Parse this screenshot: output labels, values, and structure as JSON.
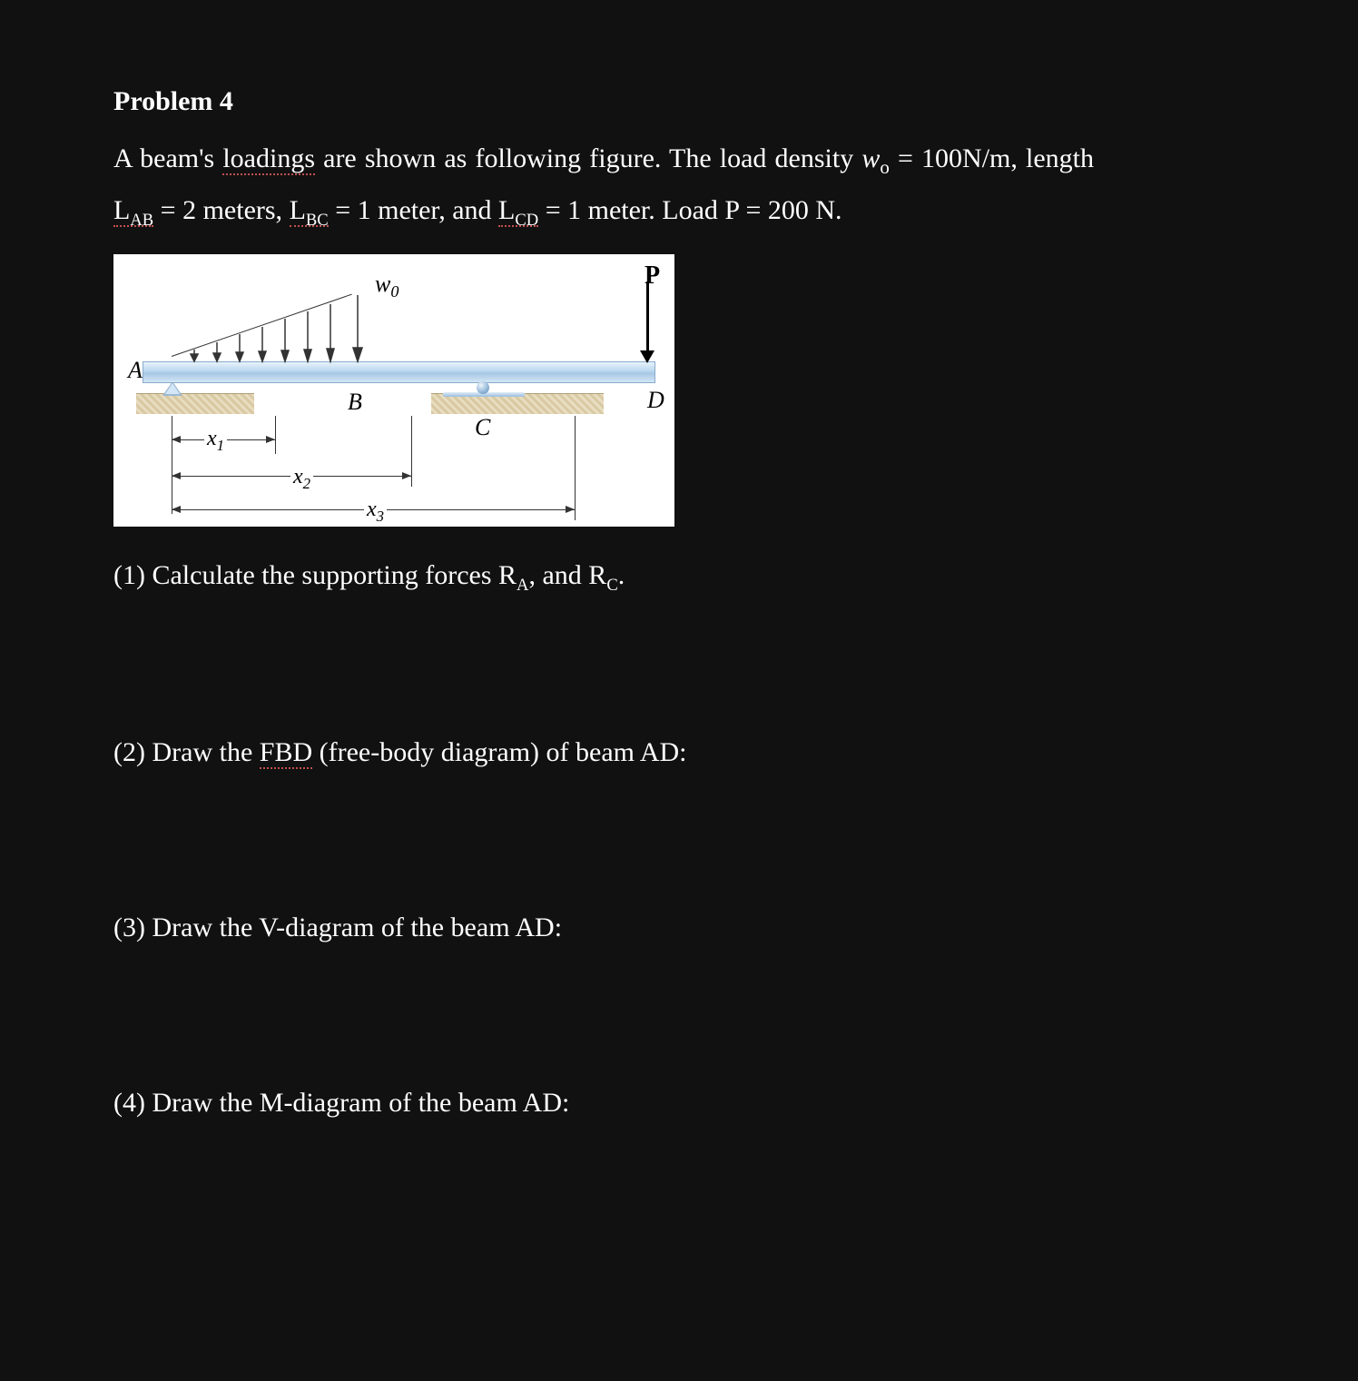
{
  "heading": "Problem 4",
  "desc_part1": "A beam's ",
  "desc_loadings": "loadings",
  "desc_part2": " are shown as following figure. The load density ",
  "wo_sym": "w",
  "wo_sub": "o",
  "desc_part3": " = 100N/m, length ",
  "L_txt": "L",
  "AB_sub": "AB",
  "eq2m": " =  2 meters, ",
  "BC_sub": "BC",
  "eq1m": " = 1 meter, and ",
  "CD_sub": "CD",
  "eq1m2": " = 1 meter. Load P = 200 N.",
  "fig": {
    "A": "A",
    "B": "B",
    "C": "C",
    "D": "D",
    "P": "P",
    "w0": "w",
    "w0sub": "0",
    "x1": "x",
    "x1sub": "1",
    "x2": "x",
    "x2sub": "2",
    "x3": "x",
    "x3sub": "3"
  },
  "q1_a": "(1) Calculate the supporting forces R",
  "q1_subA": "A",
  "q1_b": ", and R",
  "q1_subC": "C",
  "q1_c": ".",
  "q2_a": "(2) Draw the ",
  "q2_fbd": "FBD",
  "q2_b": " (free-body diagram) of beam AD:",
  "q3": "(3) Draw the V-diagram of the beam AD:",
  "q4": "(4) Draw the M-diagram of the beam AD:"
}
